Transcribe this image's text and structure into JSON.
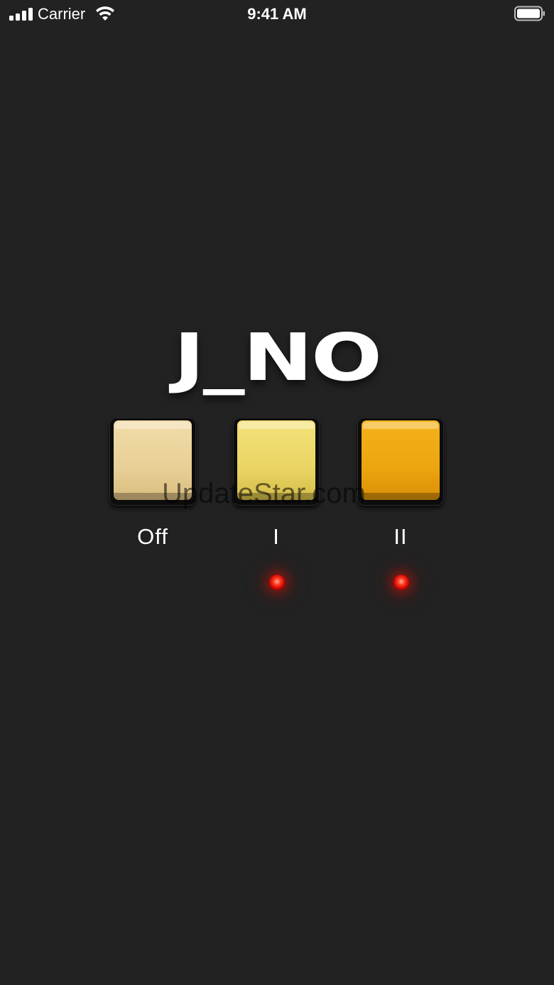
{
  "status_bar": {
    "carrier": "Carrier",
    "time": "9:41 AM",
    "signal_bars": 4
  },
  "logo": {
    "text": "J_NO"
  },
  "buttons": [
    {
      "id": "off",
      "label": "Off",
      "color": "#eed6a0",
      "led_on": false
    },
    {
      "id": "i",
      "label": "I",
      "color": "#efdc6e",
      "led_on": true
    },
    {
      "id": "ii",
      "label": "II",
      "color": "#f0aa12",
      "led_on": true
    }
  ],
  "watermark": {
    "text": "UpdateStar.com"
  },
  "colors": {
    "background": "#222222",
    "led": "#ff2a10"
  }
}
